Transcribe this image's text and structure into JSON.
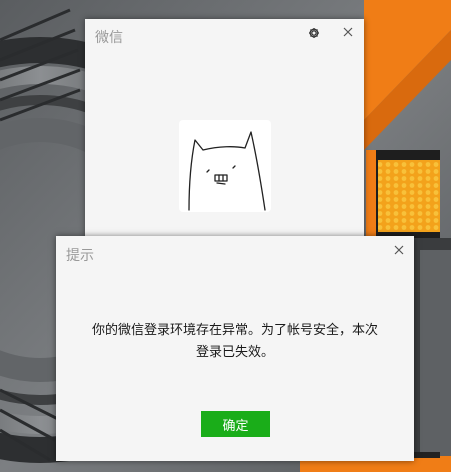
{
  "login_window": {
    "title": "微信",
    "settings_icon": "gear-icon",
    "close_icon": "close-icon",
    "avatar_icon": "doodle-cat-avatar"
  },
  "dialog": {
    "title": "提示",
    "close_icon": "close-icon",
    "message_line1": "你的微信登录环境存在异常。为了帐号安全，本次",
    "message_line2": "登录已失效。",
    "ok_label": "确定"
  },
  "colors": {
    "window_bg": "#f5f5f5",
    "title_gray": "#999999",
    "button_green": "#1aad19",
    "desktop_orange": "#f07d16"
  }
}
